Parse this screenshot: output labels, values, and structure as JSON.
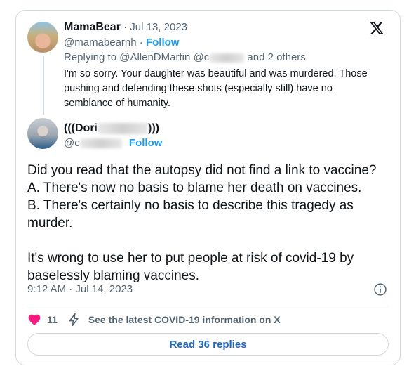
{
  "reply": {
    "author_name": "MamaBear",
    "date": "Jul 13, 2023",
    "handle": "@mamabearnh",
    "follow": "Follow",
    "replying_to_prefix": "Replying to",
    "replying_to_user": "@AllenDMartin",
    "replying_to_partial": "@c",
    "replying_to_suffix": "and 2 others",
    "text": "I'm so sorry. Your daughter was beautiful and was murdered. Those pushing and defending these shots (especially still) have no semblance of humanity."
  },
  "main": {
    "author_name_partial": "(((Dori",
    "author_name_tail": ")))",
    "handle_partial": "@c",
    "follow": "Follow",
    "para1_line1": "Did you read that the autopsy did not find a link to vaccine?",
    "para1_line2": "A. There's now no basis to blame her death on vaccines.",
    "para1_line3": "B. There's certainly no basis to describe this tragedy as murder.",
    "para2": "It's wrong to use her to put people at risk of covid-19 by baselessly blaming vaccines.",
    "timestamp": "9:12 AM · Jul 14, 2023"
  },
  "actions": {
    "like_count": "11",
    "covid_info": "See the latest COVID-19 information on X",
    "read_replies": "Read 36 replies"
  },
  "icons": {
    "logo": "x-logo-icon",
    "info": "info-icon",
    "like": "heart-icon",
    "covid": "lightning-icon"
  },
  "colors": {
    "accent": "#1d9bf0",
    "heart": "#f91880",
    "muted": "#536471"
  }
}
